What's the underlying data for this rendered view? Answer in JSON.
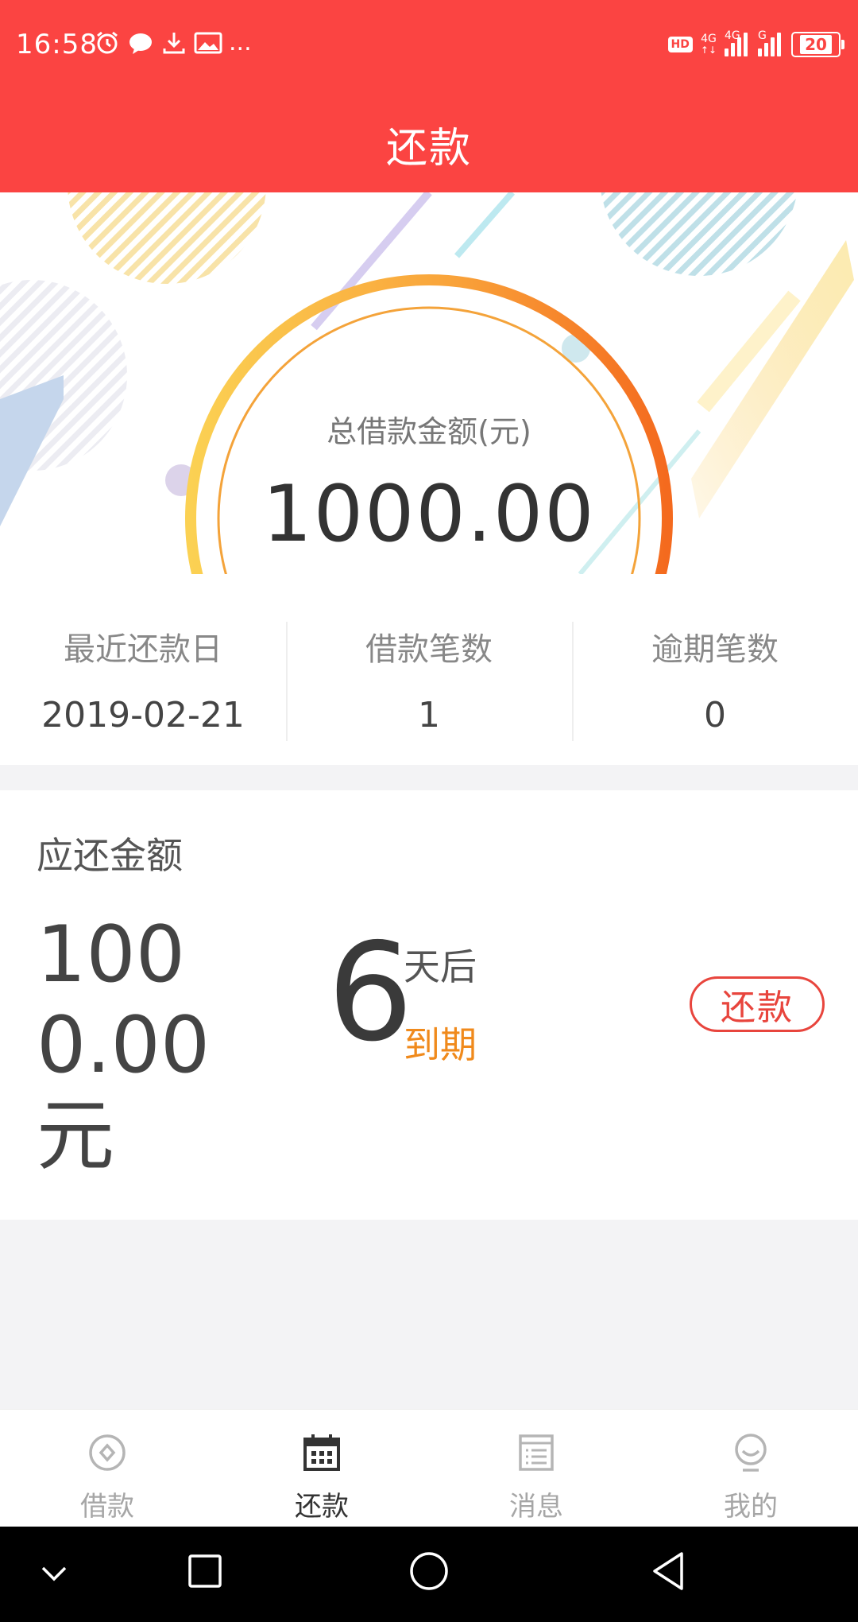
{
  "status_bar": {
    "time": "16:58",
    "more": "...",
    "hd": "HD",
    "net1": "4G",
    "net2": "4G",
    "net3": "G",
    "battery": "20"
  },
  "header": {
    "title": "还款"
  },
  "hero": {
    "label": "总借款金额(元)",
    "amount": "1000.00"
  },
  "stats": [
    {
      "label": "最近还款日",
      "value": "2019-02-21"
    },
    {
      "label": "借款笔数",
      "value": "1"
    },
    {
      "label": "逾期笔数",
      "value": "0"
    }
  ],
  "due": {
    "title": "应还金额",
    "amount": "1000.00元",
    "days": "6",
    "after": "天后",
    "expire": "到期",
    "button": "还款"
  },
  "tabs": [
    {
      "label": "借款",
      "icon": "coin-icon",
      "active": false
    },
    {
      "label": "还款",
      "icon": "calendar-icon",
      "active": true
    },
    {
      "label": "消息",
      "icon": "message-list-icon",
      "active": false
    },
    {
      "label": "我的",
      "icon": "profile-icon",
      "active": false
    }
  ],
  "colors": {
    "brand_red": "#fb4442",
    "accent_orange": "#f08a1c",
    "button_red": "#e8453d"
  }
}
